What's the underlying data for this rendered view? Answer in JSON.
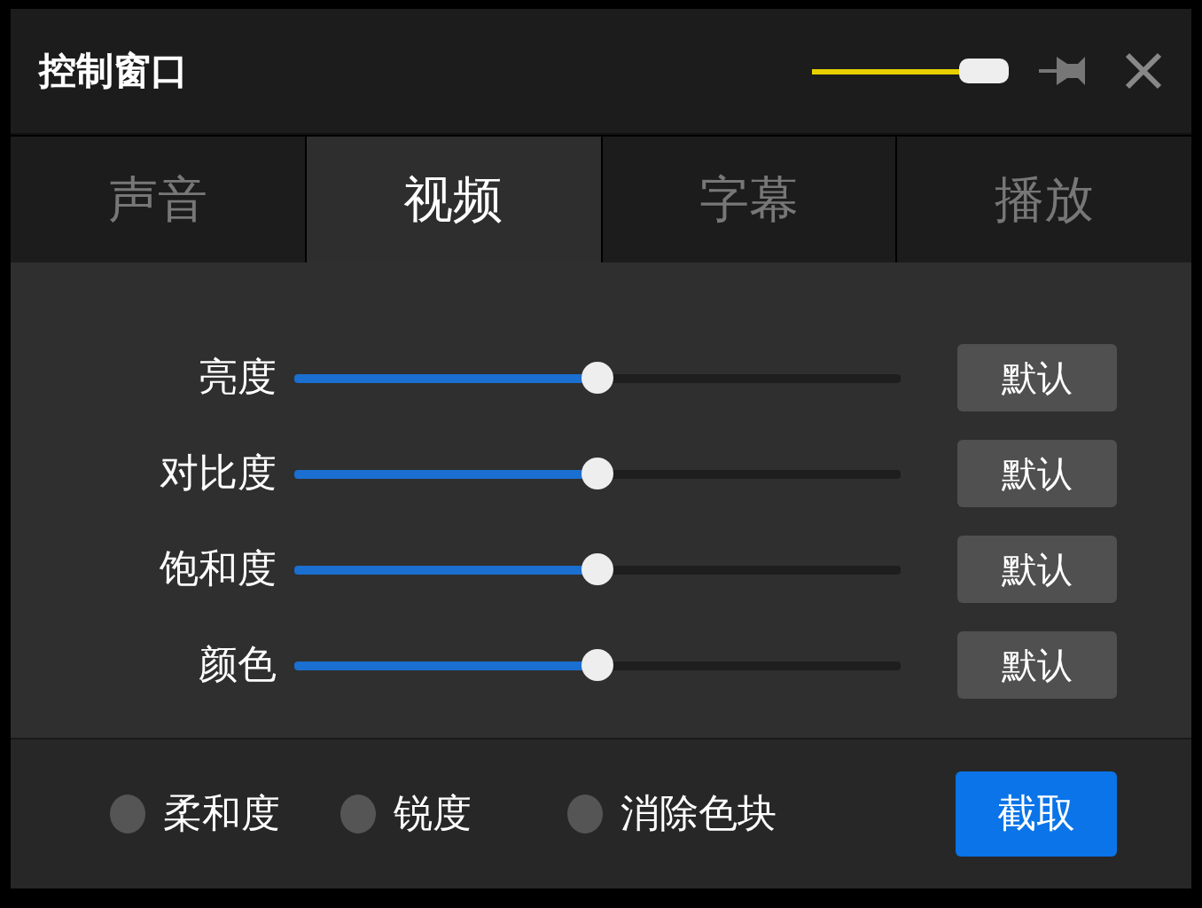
{
  "window": {
    "title": "控制窗口",
    "opacity": {
      "level": 0.88
    }
  },
  "tabs": [
    {
      "label": "声音",
      "selected": false
    },
    {
      "label": "视频",
      "selected": true
    },
    {
      "label": "字幕",
      "selected": false
    },
    {
      "label": "播放",
      "selected": false
    }
  ],
  "sliders": [
    {
      "label": "亮度",
      "level": 0.5,
      "button": "默认"
    },
    {
      "label": "对比度",
      "level": 0.5,
      "button": "默认"
    },
    {
      "label": "饱和度",
      "level": 0.5,
      "button": "默认"
    },
    {
      "label": "颜色",
      "level": 0.5,
      "button": "默认"
    }
  ],
  "options": [
    {
      "label": "柔和度",
      "checked": false
    },
    {
      "label": "锐度",
      "checked": false
    },
    {
      "label": "消除色块",
      "checked": false
    }
  ],
  "capture_button": "截取"
}
